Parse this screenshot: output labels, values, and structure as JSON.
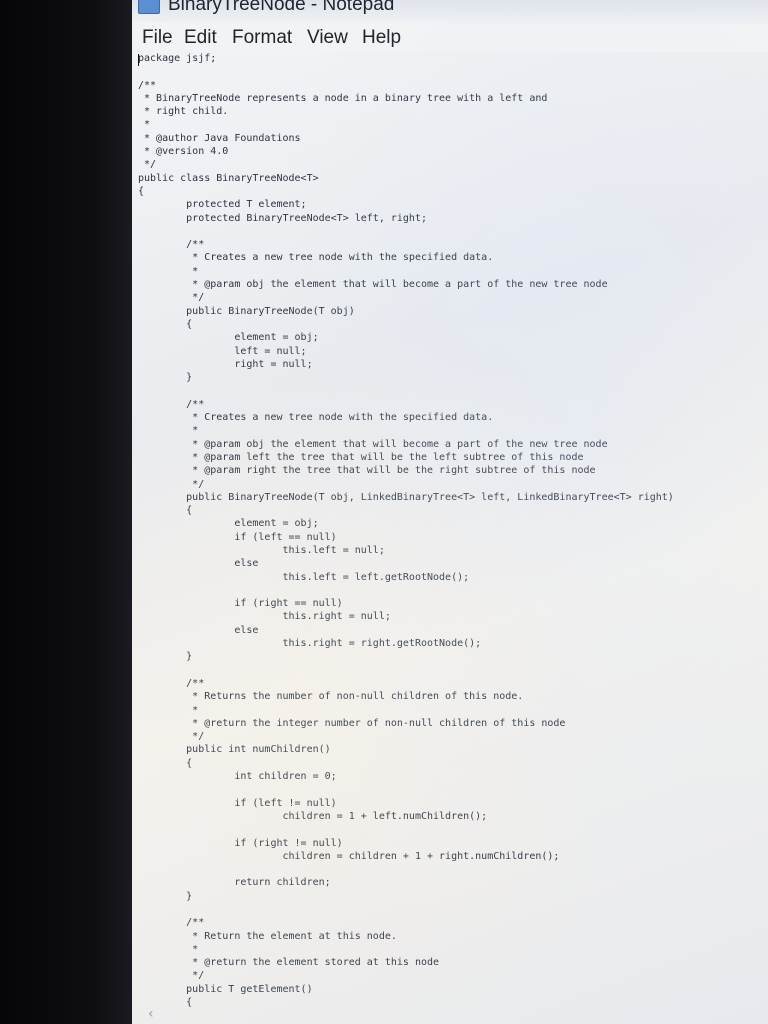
{
  "window": {
    "title": "BinaryTreeNode - Notepad",
    "app_icon": "notepad-icon"
  },
  "menu": [
    {
      "label": "File"
    },
    {
      "label": "Edit"
    },
    {
      "label": "Format"
    },
    {
      "label": "View"
    },
    {
      "label": "Help"
    }
  ],
  "editor": {
    "lines": [
      "package jsjf;",
      "",
      "/**",
      " * BinaryTreeNode represents a node in a binary tree with a left and",
      " * right child.",
      " *",
      " * @author Java Foundations",
      " * @version 4.0",
      " */",
      "public class BinaryTreeNode<T>",
      "{",
      "        protected T element;",
      "        protected BinaryTreeNode<T> left, right;",
      "",
      "        /**",
      "         * Creates a new tree node with the specified data.",
      "         *",
      "         * @param obj the element that will become a part of the new tree node",
      "         */",
      "        public BinaryTreeNode(T obj)",
      "        {",
      "                element = obj;",
      "                left = null;",
      "                right = null;",
      "        }",
      "",
      "        /**",
      "         * Creates a new tree node with the specified data.",
      "         *",
      "         * @param obj the element that will become a part of the new tree node",
      "         * @param left the tree that will be the left subtree of this node",
      "         * @param right the tree that will be the right subtree of this node",
      "         */",
      "        public BinaryTreeNode(T obj, LinkedBinaryTree<T> left, LinkedBinaryTree<T> right)",
      "        {",
      "                element = obj;",
      "                if (left == null)",
      "                        this.left = null;",
      "                else",
      "                        this.left = left.getRootNode();",
      "",
      "                if (right == null)",
      "                        this.right = null;",
      "                else",
      "                        this.right = right.getRootNode();",
      "        }",
      "",
      "        /**",
      "         * Returns the number of non-null children of this node.",
      "         *",
      "         * @return the integer number of non-null children of this node",
      "         */",
      "        public int numChildren()",
      "        {",
      "                int children = 0;",
      "",
      "                if (left != null)",
      "                        children = 1 + left.numChildren();",
      "",
      "                if (right != null)",
      "                        children = children + 1 + right.numChildren();",
      "",
      "                return children;",
      "        }",
      "",
      "        /**",
      "         * Return the element at this node.",
      "         *",
      "         * @return the element stored at this node",
      "         */",
      "        public T getElement()",
      "        {"
    ]
  }
}
